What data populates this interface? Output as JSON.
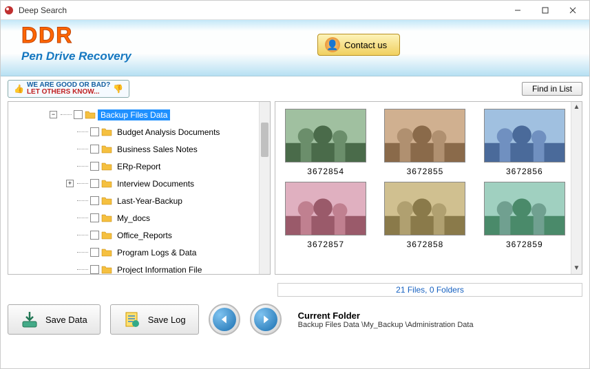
{
  "window": {
    "title": "Deep Search"
  },
  "header": {
    "logo_text": "DDR",
    "product_name": "Pen Drive Recovery",
    "contact_label": "Contact us"
  },
  "feedback": {
    "line1": "WE ARE GOOD OR BAD?",
    "line2": "LET OTHERS KNOW..."
  },
  "toolbar": {
    "find_label": "Find in List"
  },
  "tree": {
    "items": [
      {
        "label": "Backup Files Data",
        "selected": true,
        "expandable": true,
        "expanded": true,
        "level": 0
      },
      {
        "label": "Budget Analysis Documents",
        "selected": false,
        "expandable": false,
        "level": 1
      },
      {
        "label": "Business Sales Notes",
        "selected": false,
        "expandable": false,
        "level": 1
      },
      {
        "label": "ERp-Report",
        "selected": false,
        "expandable": false,
        "level": 1
      },
      {
        "label": "Interview Documents",
        "selected": false,
        "expandable": true,
        "expanded": false,
        "level": 1
      },
      {
        "label": "Last-Year-Backup",
        "selected": false,
        "expandable": false,
        "level": 1
      },
      {
        "label": "My_docs",
        "selected": false,
        "expandable": false,
        "level": 1
      },
      {
        "label": "Office_Reports",
        "selected": false,
        "expandable": false,
        "level": 1
      },
      {
        "label": "Program Logs & Data",
        "selected": false,
        "expandable": false,
        "level": 1
      },
      {
        "label": "Project Information File",
        "selected": false,
        "expandable": false,
        "level": 1
      }
    ]
  },
  "thumbnails": {
    "items": [
      {
        "name": "3672854"
      },
      {
        "name": "3672855"
      },
      {
        "name": "3672856"
      },
      {
        "name": "3672857"
      },
      {
        "name": "3672858"
      },
      {
        "name": "3672859"
      }
    ]
  },
  "status": {
    "summary": "21 Files, 0 Folders"
  },
  "actions": {
    "save_data": "Save Data",
    "save_log": "Save Log"
  },
  "current_folder": {
    "heading": "Current Folder",
    "path": "Backup Files Data \\My_Backup \\Administration Data"
  }
}
